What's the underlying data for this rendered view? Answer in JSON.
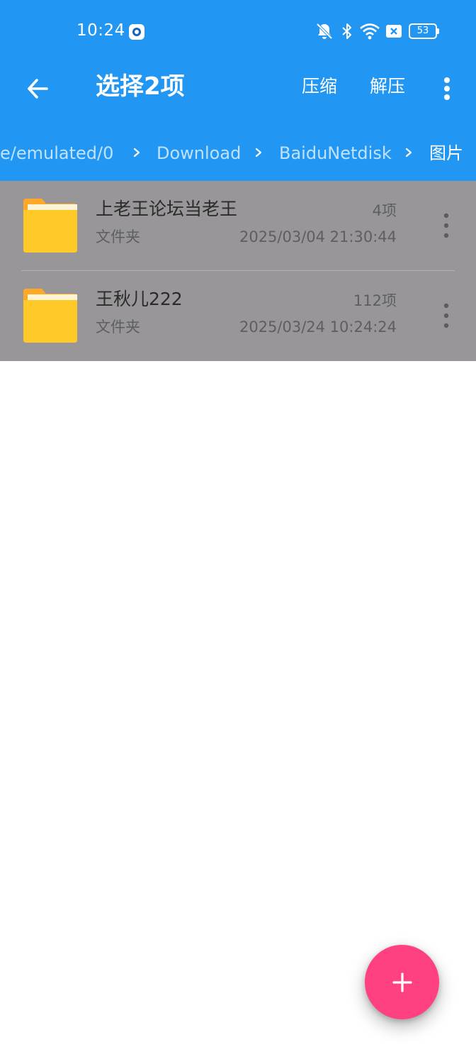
{
  "status_bar": {
    "time": "10:24",
    "battery_level": "53",
    "icons": [
      "app-notification-icon",
      "bell-off-icon",
      "bluetooth-icon",
      "wifi-icon",
      "sim-x-icon",
      "battery-icon"
    ]
  },
  "toolbar": {
    "back_icon": "arrow-left-icon",
    "title": "选择2项",
    "compress_label": "压缩",
    "extract_label": "解压",
    "more_icon": "more-vertical-icon"
  },
  "breadcrumb": {
    "items": [
      {
        "label": "e/emulated/0"
      },
      {
        "label": "Download"
      },
      {
        "label": "BaiduNetdisk"
      },
      {
        "label": "图片"
      }
    ],
    "separator_icon": "chevron-right-icon"
  },
  "files": [
    {
      "name": "上老王论坛当老王",
      "type": "文件夹",
      "count": "4项",
      "date": "2025/03/04 21:30:44",
      "icon": "folder-icon",
      "selected": true
    },
    {
      "name": "王秋儿222",
      "type": "文件夹",
      "count": "112项",
      "date": "2025/03/24 10:24:24",
      "icon": "folder-icon",
      "selected": true
    }
  ],
  "fab": {
    "icon": "plus-icon"
  },
  "colors": {
    "primary": "#2196F3",
    "accent": "#FF4081",
    "folder": "#FFCA28",
    "selected_overlay": "#989698"
  }
}
